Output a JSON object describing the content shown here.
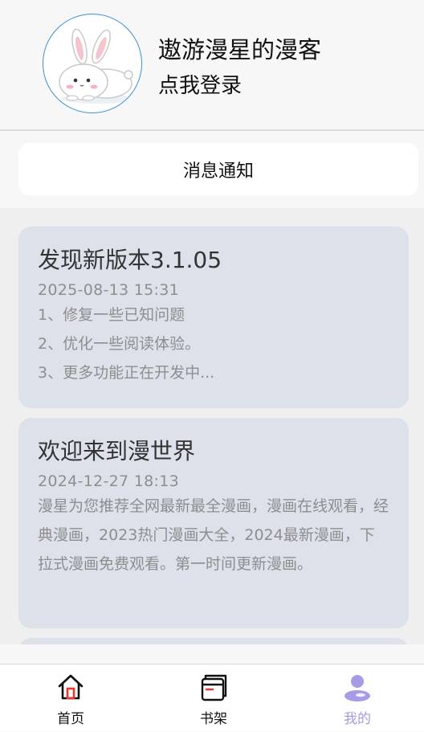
{
  "profile": {
    "avatar_icon": "bunny-avatar-icon",
    "username": "遨游漫星的漫客",
    "login_label": "点我登录"
  },
  "notifications_button": {
    "label": "消息通知"
  },
  "notices": [
    {
      "title": "发现新版本3.1.05",
      "date": "2025-08-13 15:31",
      "lines": [
        "1、修复一些已知问题",
        "2、优化一些阅读体验。",
        "3、更多功能正在开发中..."
      ]
    },
    {
      "title": "欢迎来到漫世界",
      "date": "2024-12-27 18:13",
      "body": "漫星为您推荐全网最新最全漫画，漫画在线观看，经典漫画，2023热门漫画大全，2024最新漫画，下拉式漫画免费观看。第一时间更新漫画。"
    }
  ],
  "tabbar": {
    "tabs": [
      {
        "label": "首页",
        "icon": "home-icon"
      },
      {
        "label": "书架",
        "icon": "bookshelf-icon"
      },
      {
        "label": "我的",
        "icon": "user-icon",
        "active": true
      }
    ],
    "active_color": "#a99ae8"
  },
  "colors": {
    "card_bg": "#dce1ea",
    "avatar_border": "#3b8fd9"
  }
}
